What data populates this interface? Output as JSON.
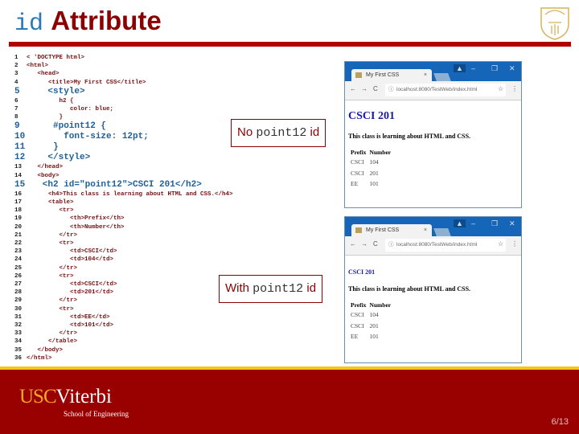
{
  "title": {
    "code": "id",
    "word": "Attribute"
  },
  "code_lines": [
    {
      "n": "1",
      "t": "< 'DOCTYPE html>",
      "big": false
    },
    {
      "n": "2",
      "t": "<html>",
      "big": false
    },
    {
      "n": "3",
      "t": "   <head>",
      "big": false
    },
    {
      "n": "4",
      "t": "      <title>My First CSS</title>",
      "big": false
    },
    {
      "n": "5",
      "t": "    <style>",
      "big": true
    },
    {
      "n": "6",
      "t": "         h2 {",
      "big": false
    },
    {
      "n": "7",
      "t": "            color: blue;",
      "big": false
    },
    {
      "n": "8",
      "t": "         }",
      "big": false
    },
    {
      "n": "9",
      "t": "     #point12 {",
      "big": true
    },
    {
      "n": "10",
      "t": "       font-size: 12pt;",
      "big": true
    },
    {
      "n": "11",
      "t": "     }",
      "big": true
    },
    {
      "n": "12",
      "t": "    </style>",
      "big": true
    },
    {
      "n": "13",
      "t": "   </head>",
      "big": false
    },
    {
      "n": "14",
      "t": "   <body>",
      "big": false
    },
    {
      "n": "15",
      "t": "   <h2 id=\"point12\">CSCI 201</h2>",
      "big": true
    },
    {
      "n": "16",
      "t": "      <h4>This class is learning about HTML and CSS.</h4>",
      "big": false
    },
    {
      "n": "17",
      "t": "      <table>",
      "big": false
    },
    {
      "n": "18",
      "t": "         <tr>",
      "big": false
    },
    {
      "n": "19",
      "t": "            <th>Prefix</th>",
      "big": false
    },
    {
      "n": "20",
      "t": "            <th>Number</th>",
      "big": false
    },
    {
      "n": "21",
      "t": "         </tr>",
      "big": false
    },
    {
      "n": "22",
      "t": "         <tr>",
      "big": false
    },
    {
      "n": "23",
      "t": "            <td>CSCI</td>",
      "big": false
    },
    {
      "n": "24",
      "t": "            <td>104</td>",
      "big": false
    },
    {
      "n": "25",
      "t": "         </tr>",
      "big": false
    },
    {
      "n": "26",
      "t": "         <tr>",
      "big": false
    },
    {
      "n": "27",
      "t": "            <td>CSCI</td>",
      "big": false
    },
    {
      "n": "28",
      "t": "            <td>201</td>",
      "big": false
    },
    {
      "n": "29",
      "t": "         </tr>",
      "big": false
    },
    {
      "n": "30",
      "t": "         <tr>",
      "big": false
    },
    {
      "n": "31",
      "t": "            <td>EE</td>",
      "big": false
    },
    {
      "n": "32",
      "t": "            <td>101</td>",
      "big": false
    },
    {
      "n": "33",
      "t": "         </tr>",
      "big": false
    },
    {
      "n": "34",
      "t": "      </table>",
      "big": false
    },
    {
      "n": "35",
      "t": "   </body>",
      "big": false
    },
    {
      "n": "36",
      "t": "</html>",
      "big": false
    }
  ],
  "labels": {
    "no": {
      "pre": "No ",
      "code": "point12",
      "post": " id"
    },
    "with": {
      "pre": "With ",
      "code": "point12",
      "post": " id"
    }
  },
  "browser": {
    "tab_title": "My First CSS",
    "tab_close": "×",
    "url": "localhost:8080/TestWeb/index.html",
    "heading": "CSCI 201",
    "paragraph": "This class is learning about HTML and CSS.",
    "headers": [
      "Prefix",
      "Number"
    ],
    "rows": [
      [
        "CSCI",
        "104"
      ],
      [
        "CSCI",
        "201"
      ],
      [
        "EE",
        "101"
      ]
    ]
  },
  "footer": {
    "usc": "USC",
    "viterbi": "Viterbi",
    "school": "School of Engineering",
    "page": "6/13"
  },
  "colors": {
    "brand_red": "#990000",
    "gold": "#f5c518",
    "code_blue": "#1f5f99"
  }
}
